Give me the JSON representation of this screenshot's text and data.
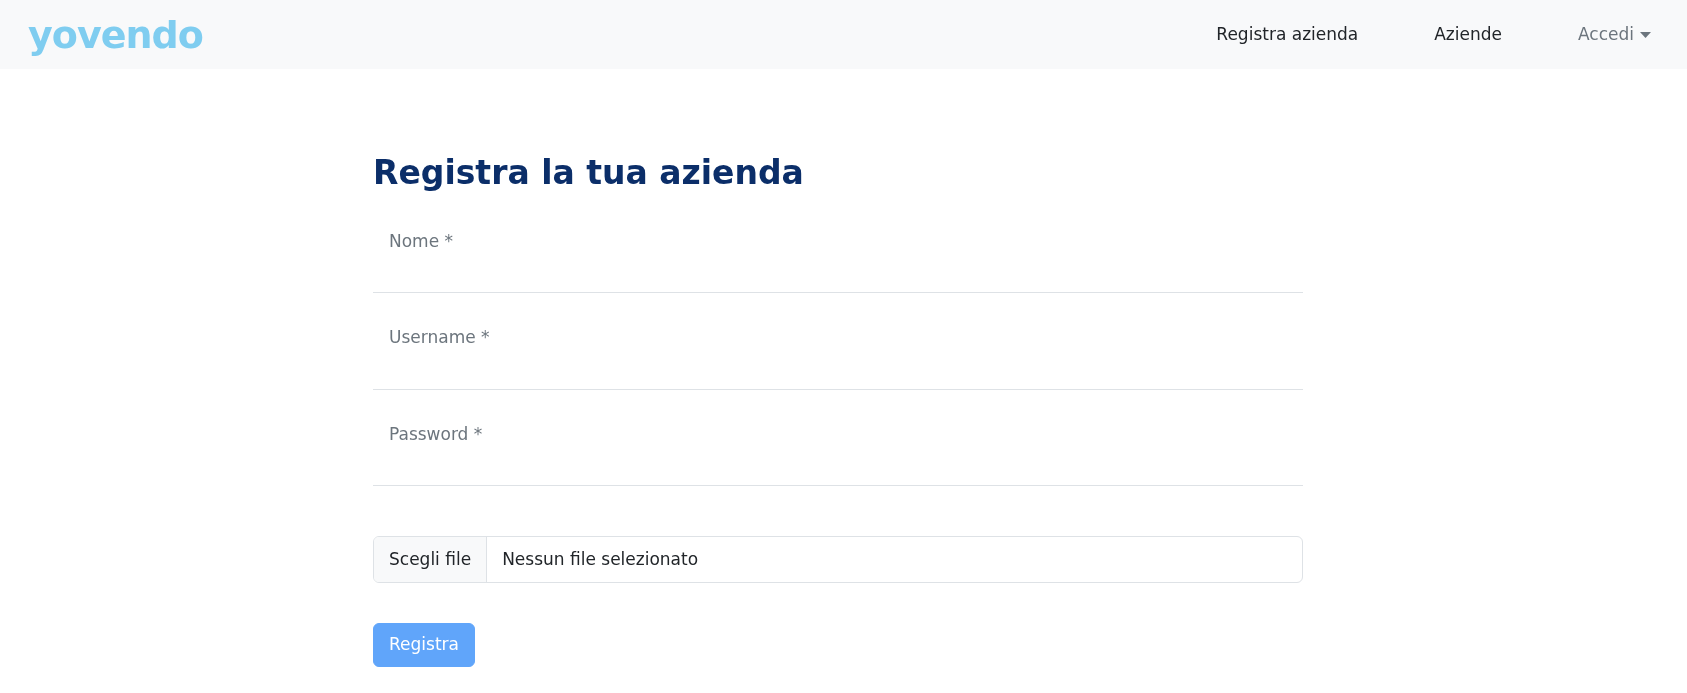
{
  "navbar": {
    "brand": "yovendo",
    "links": [
      {
        "label": "Registra azienda",
        "kind": "link"
      },
      {
        "label": "Aziende",
        "kind": "link"
      },
      {
        "label": "Accedi",
        "kind": "dropdown"
      }
    ]
  },
  "form": {
    "title": "Registra la tua azienda",
    "fields": [
      {
        "placeholder": "Nome *"
      },
      {
        "placeholder": "Username *"
      },
      {
        "placeholder": "Password *"
      }
    ],
    "file": {
      "button": "Scegli file",
      "status": "Nessun file selezionato"
    },
    "submit": {
      "label": "Registra",
      "disabled": true
    }
  }
}
